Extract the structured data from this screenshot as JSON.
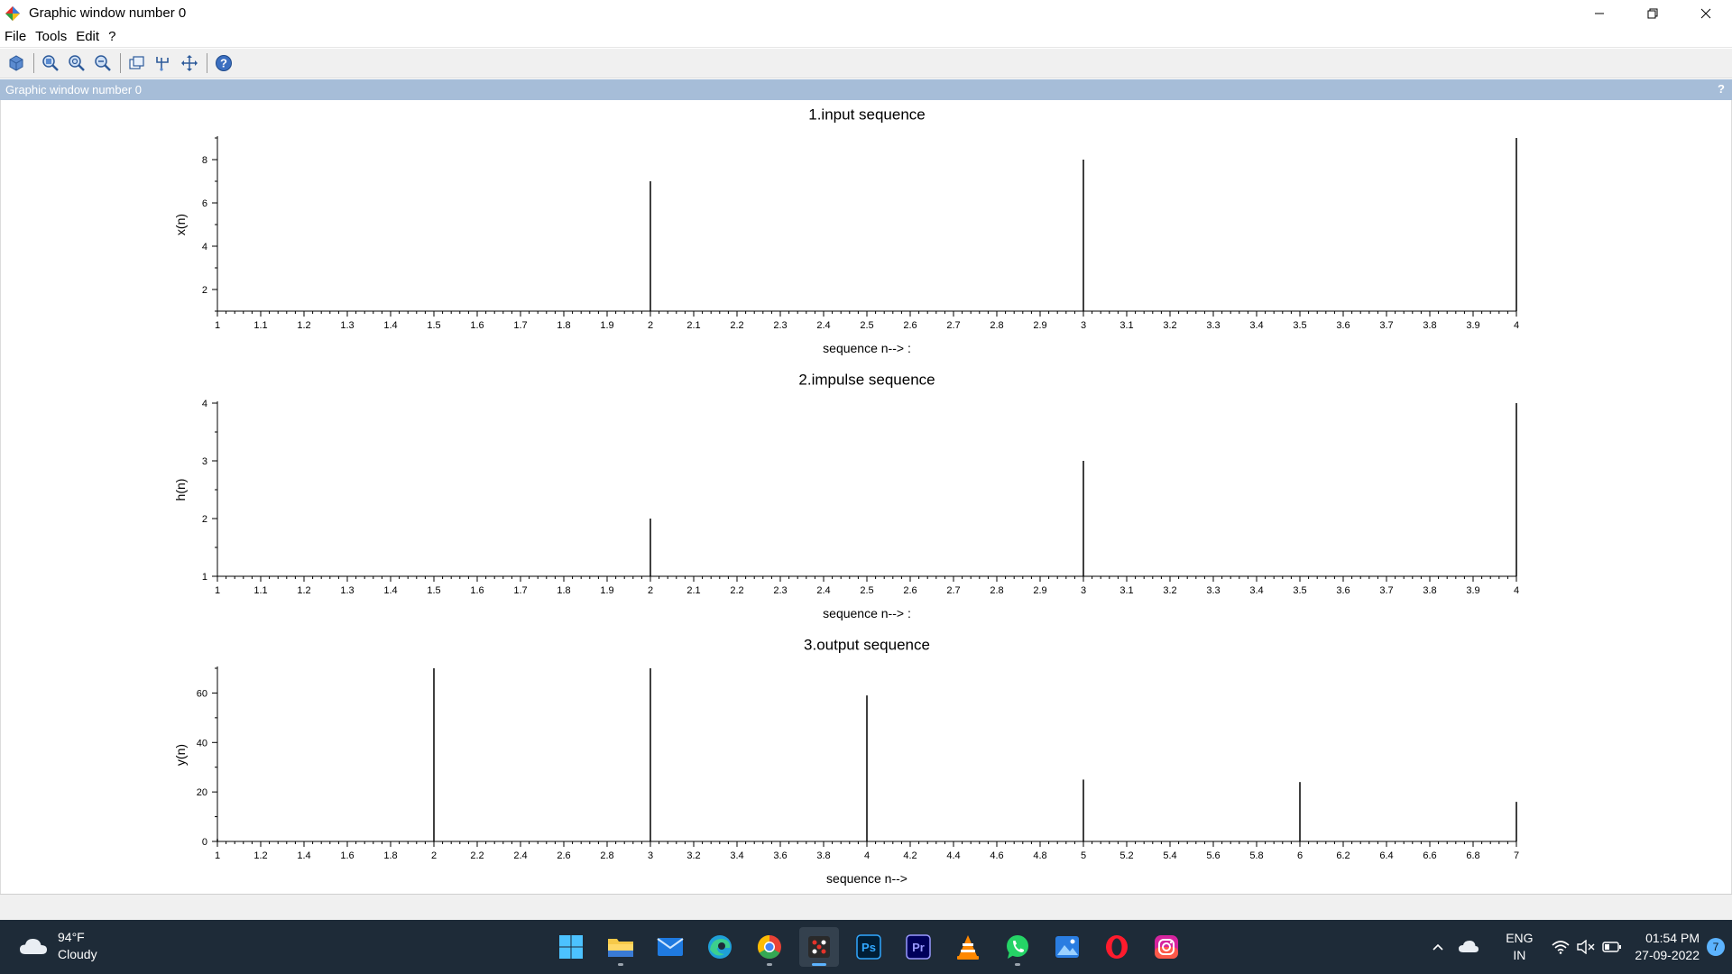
{
  "window": {
    "title": "Graphic window number 0",
    "controls": {
      "minimize": "—",
      "restore": "❐",
      "close": "✕"
    }
  },
  "menu": {
    "items": [
      "File",
      "Tools",
      "Edit",
      "?"
    ]
  },
  "toolbar": {
    "icons": [
      "rotate-icon",
      "zoom-in-icon",
      "zoom-out-icon",
      "zoom-fit-icon",
      "datatip-icon",
      "editor-icon",
      "pan-icon",
      "help-icon"
    ]
  },
  "panel": {
    "title": "Graphic window number 0",
    "help": "?"
  },
  "chart_data": [
    {
      "type": "bar",
      "title": "1.input sequence",
      "xlabel": "sequence n--> :",
      "ylabel": "x(n)",
      "xlim": [
        1,
        4
      ],
      "ylim": [
        1,
        9
      ],
      "xticks": [
        1,
        1.1,
        1.2,
        1.3,
        1.4,
        1.5,
        1.6,
        1.7,
        1.8,
        1.9,
        2,
        2.1,
        2.2,
        2.3,
        2.4,
        2.5,
        2.6,
        2.7,
        2.8,
        2.9,
        3,
        3.1,
        3.2,
        3.3,
        3.4,
        3.5,
        3.6,
        3.7,
        3.8,
        3.9,
        4
      ],
      "yticks": [
        2,
        4,
        6,
        8
      ],
      "x": [
        1,
        2,
        3,
        4
      ],
      "values": [
        1,
        7,
        8,
        9
      ]
    },
    {
      "type": "bar",
      "title": "2.impulse sequence",
      "xlabel": "sequence n--> :",
      "ylabel": "h(n)",
      "xlim": [
        1,
        4
      ],
      "ylim": [
        1,
        4
      ],
      "xticks": [
        1,
        1.1,
        1.2,
        1.3,
        1.4,
        1.5,
        1.6,
        1.7,
        1.8,
        1.9,
        2,
        2.1,
        2.2,
        2.3,
        2.4,
        2.5,
        2.6,
        2.7,
        2.8,
        2.9,
        3,
        3.1,
        3.2,
        3.3,
        3.4,
        3.5,
        3.6,
        3.7,
        3.8,
        3.9,
        4
      ],
      "yticks": [
        1,
        2,
        3,
        4
      ],
      "x": [
        1,
        2,
        3,
        4
      ],
      "values": [
        1,
        2,
        3,
        4
      ]
    },
    {
      "type": "bar",
      "title": "3.output sequence",
      "xlabel": "sequence n-->",
      "ylabel": "y(n)",
      "xlim": [
        1,
        7
      ],
      "ylim": [
        0,
        70
      ],
      "xticks": [
        1,
        1.2,
        1.4,
        1.6,
        1.8,
        2,
        2.2,
        2.4,
        2.6,
        2.8,
        3,
        3.2,
        3.4,
        3.6,
        3.8,
        4,
        4.2,
        4.4,
        4.6,
        4.8,
        5,
        5.2,
        5.4,
        5.6,
        5.8,
        6,
        6.2,
        6.4,
        6.6,
        6.8,
        7
      ],
      "yticks": [
        0,
        20,
        40,
        60
      ],
      "x": [
        1,
        2,
        3,
        4,
        5,
        6,
        7
      ],
      "values": [
        1,
        70,
        70,
        59,
        25,
        24,
        16
      ]
    }
  ],
  "taskbar": {
    "weather": {
      "temp": "94°F",
      "condition": "Cloudy"
    },
    "apps": [
      "windows-start-icon",
      "file-explorer-icon",
      "mail-icon",
      "edge-icon",
      "chrome-icon",
      "scilab-icon",
      "photoshop-icon",
      "premiere-icon",
      "vlc-icon",
      "whatsapp-icon",
      "photos-icon",
      "opera-icon",
      "instagram-icon"
    ],
    "tray": {
      "lang_line1": "ENG",
      "lang_line2": "IN",
      "time": "01:54 PM",
      "date": "27-09-2022",
      "notifications": "7"
    },
    "colors": {
      "accent": "#5cb3ff",
      "background": "#1e2b38"
    }
  }
}
